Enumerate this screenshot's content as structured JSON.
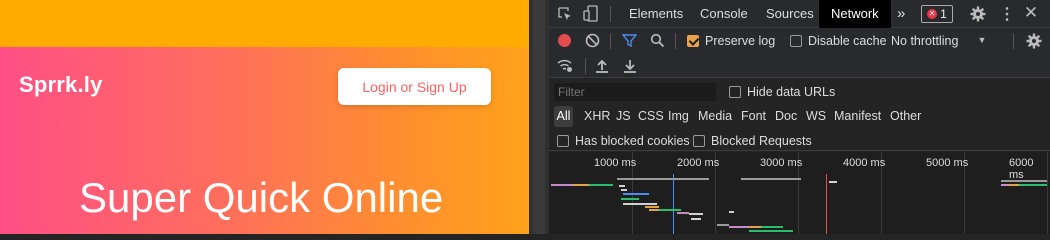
{
  "site": {
    "logo": "Sprrk.ly",
    "login_button": "Login or Sign Up",
    "headline": "Super Quick Online"
  },
  "devtools": {
    "tabs": [
      {
        "label": "Elements",
        "active": false
      },
      {
        "label": "Console",
        "active": false
      },
      {
        "label": "Sources",
        "active": false
      },
      {
        "label": "Network",
        "active": true
      }
    ],
    "more_tabs": "»",
    "error_count": "1",
    "toolbar": {
      "preserve_log_label": "Preserve log",
      "preserve_log_checked": true,
      "disable_cache_label": "Disable cache",
      "disable_cache_checked": false,
      "throttling": "No throttling"
    },
    "filter": {
      "placeholder": "Filter",
      "hide_data_urls_label": "Hide data URLs"
    },
    "resource_types": [
      "All",
      "XHR",
      "JS",
      "CSS",
      "Img",
      "Media",
      "Font",
      "Doc",
      "WS",
      "Manifest",
      "Other"
    ],
    "blocked": {
      "has_blocked_cookies_label": "Has blocked cookies",
      "blocked_requests_label": "Blocked Requests"
    },
    "timeline": {
      "ticks": [
        "1000 ms",
        "2000 ms",
        "3000 ms",
        "4000 ms",
        "5000 ms",
        "6000 ms"
      ]
    }
  },
  "colors": {
    "accent_orange": "#ffab00",
    "hero_gradient_start": "#ff4f86",
    "hero_gradient_end": "#ffa21a",
    "login_text": "#ff5e62",
    "devtools_bg": "#242424",
    "record_red": "#e34c4c",
    "filter_icon_blue": "#4a8cf0",
    "checkbox_orange": "#e8a34a"
  }
}
